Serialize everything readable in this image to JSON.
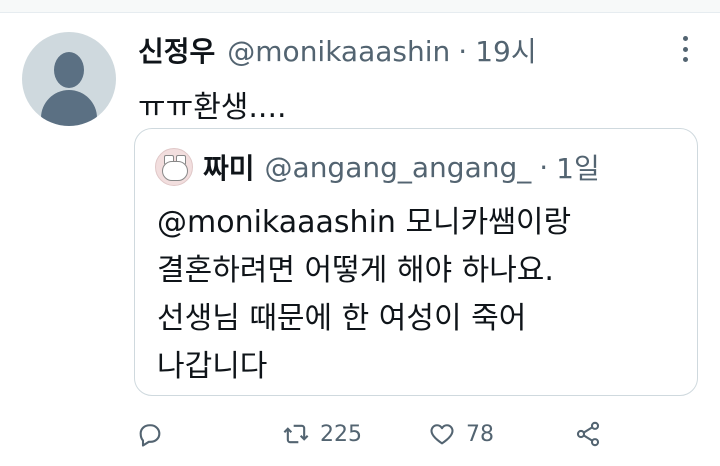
{
  "tweet": {
    "name": "신정우",
    "handle": "@monikaaashin",
    "separator": "·",
    "time": "19시",
    "text": "ㅠㅠ환생...."
  },
  "quote": {
    "name": "짜미",
    "handle": "@angang_angang_",
    "separator": "·",
    "time": "1일",
    "lines": [
      "@monikaaashin 모니카쌤이랑",
      "결혼하려면 어떻게 해야 하나요.",
      "선생님 때문에 한 여성이 죽어",
      "나갑니다"
    ]
  },
  "actions": {
    "reply_icon": "reply-icon",
    "retweet_icon": "retweet-icon",
    "retweet_count": "225",
    "like_icon": "heart-icon",
    "like_count": "78",
    "share_icon": "share-icon"
  },
  "colors": {
    "text": "#0f1419",
    "secondary": "#536471",
    "border": "#cfd9de"
  }
}
